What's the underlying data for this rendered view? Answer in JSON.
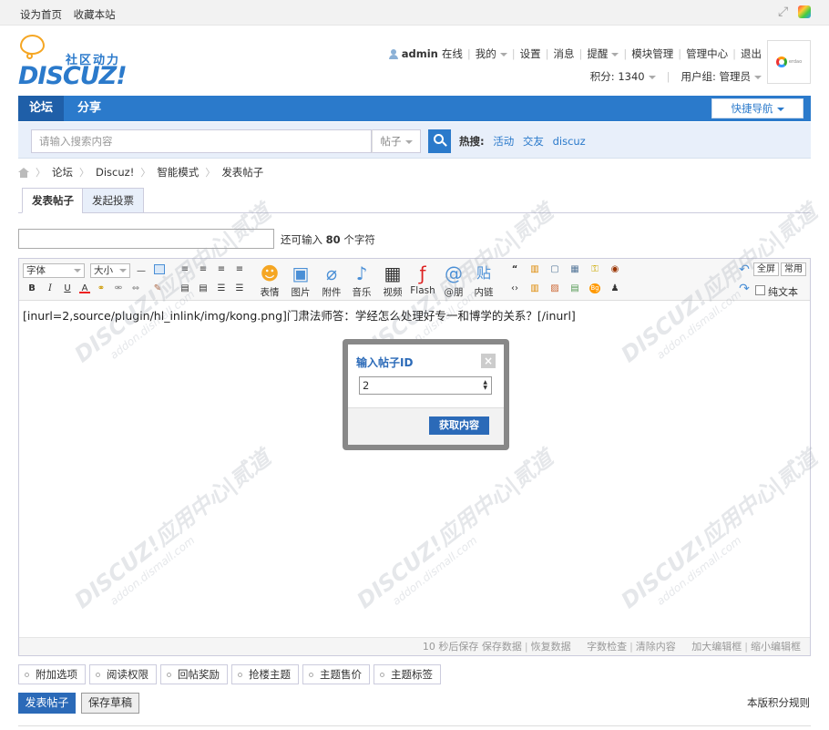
{
  "topbar": {
    "set_home": "设为首页",
    "bookmark": "收藏本站"
  },
  "logo": {
    "slogan": "社区动力",
    "word": "DISCUZ!"
  },
  "user": {
    "name": "admin",
    "status": "在线",
    "menu": [
      "我的",
      "设置",
      "消息",
      "提醒",
      "模块管理",
      "管理中心",
      "退出"
    ],
    "credits": "积分: 1340",
    "group": "用户组: 管理员"
  },
  "nav": {
    "tabs": [
      "论坛",
      "分享"
    ],
    "quick_nav": "快捷导航"
  },
  "search": {
    "placeholder": "请输入搜索内容",
    "type": "帖子",
    "hot_label": "热搜:",
    "hot_words": [
      "活动",
      "交友",
      "discuz"
    ]
  },
  "breadcrumb": [
    "论坛",
    "Discuz!",
    "智能模式",
    "发表帖子"
  ],
  "post_tabs": [
    "发表帖子",
    "发起投票"
  ],
  "title_input": {
    "value": "",
    "remain_prefix": "还可输入",
    "remain_count": "80",
    "remain_suffix": "个字符"
  },
  "editor": {
    "font_select": "字体",
    "size_select": "大小",
    "insert_tools": [
      "表情",
      "图片",
      "附件",
      "音乐",
      "视频",
      "Flash",
      "@朋",
      "内链"
    ],
    "fullscreen": "全屏",
    "common": "常用",
    "plain_text": "纯文本",
    "content": "[inurl=2,source/plugin/hl_inlink/img/kong.png]门肃法师答：学经怎么处理好专一和博学的关系？[/inurl]",
    "footer": {
      "autosave": "10 秒后保存",
      "save_data": "保存数据",
      "restore_data": "恢复数据",
      "word_check": "字数检查",
      "clear": "清除内容",
      "enlarge": "加大编辑框",
      "shrink": "缩小编辑框"
    }
  },
  "dialog": {
    "title": "输入帖子ID",
    "close": "×",
    "value": "2",
    "button": "获取内容"
  },
  "options": [
    "附加选项",
    "阅读权限",
    "回帖奖励",
    "抢楼主题",
    "主题售价",
    "主题标签"
  ],
  "actions": {
    "post": "发表帖子",
    "draft": "保存草稿",
    "rules": "本版积分规则"
  },
  "watermark": {
    "main": "DISCUZ!应用中心",
    "sub": "addon.dismall.com",
    "brand": "贰道"
  },
  "colors": {
    "brand_blue": "#2b7acb",
    "nav_active": "#1f5fa8",
    "search_bg": "#e8effa"
  }
}
